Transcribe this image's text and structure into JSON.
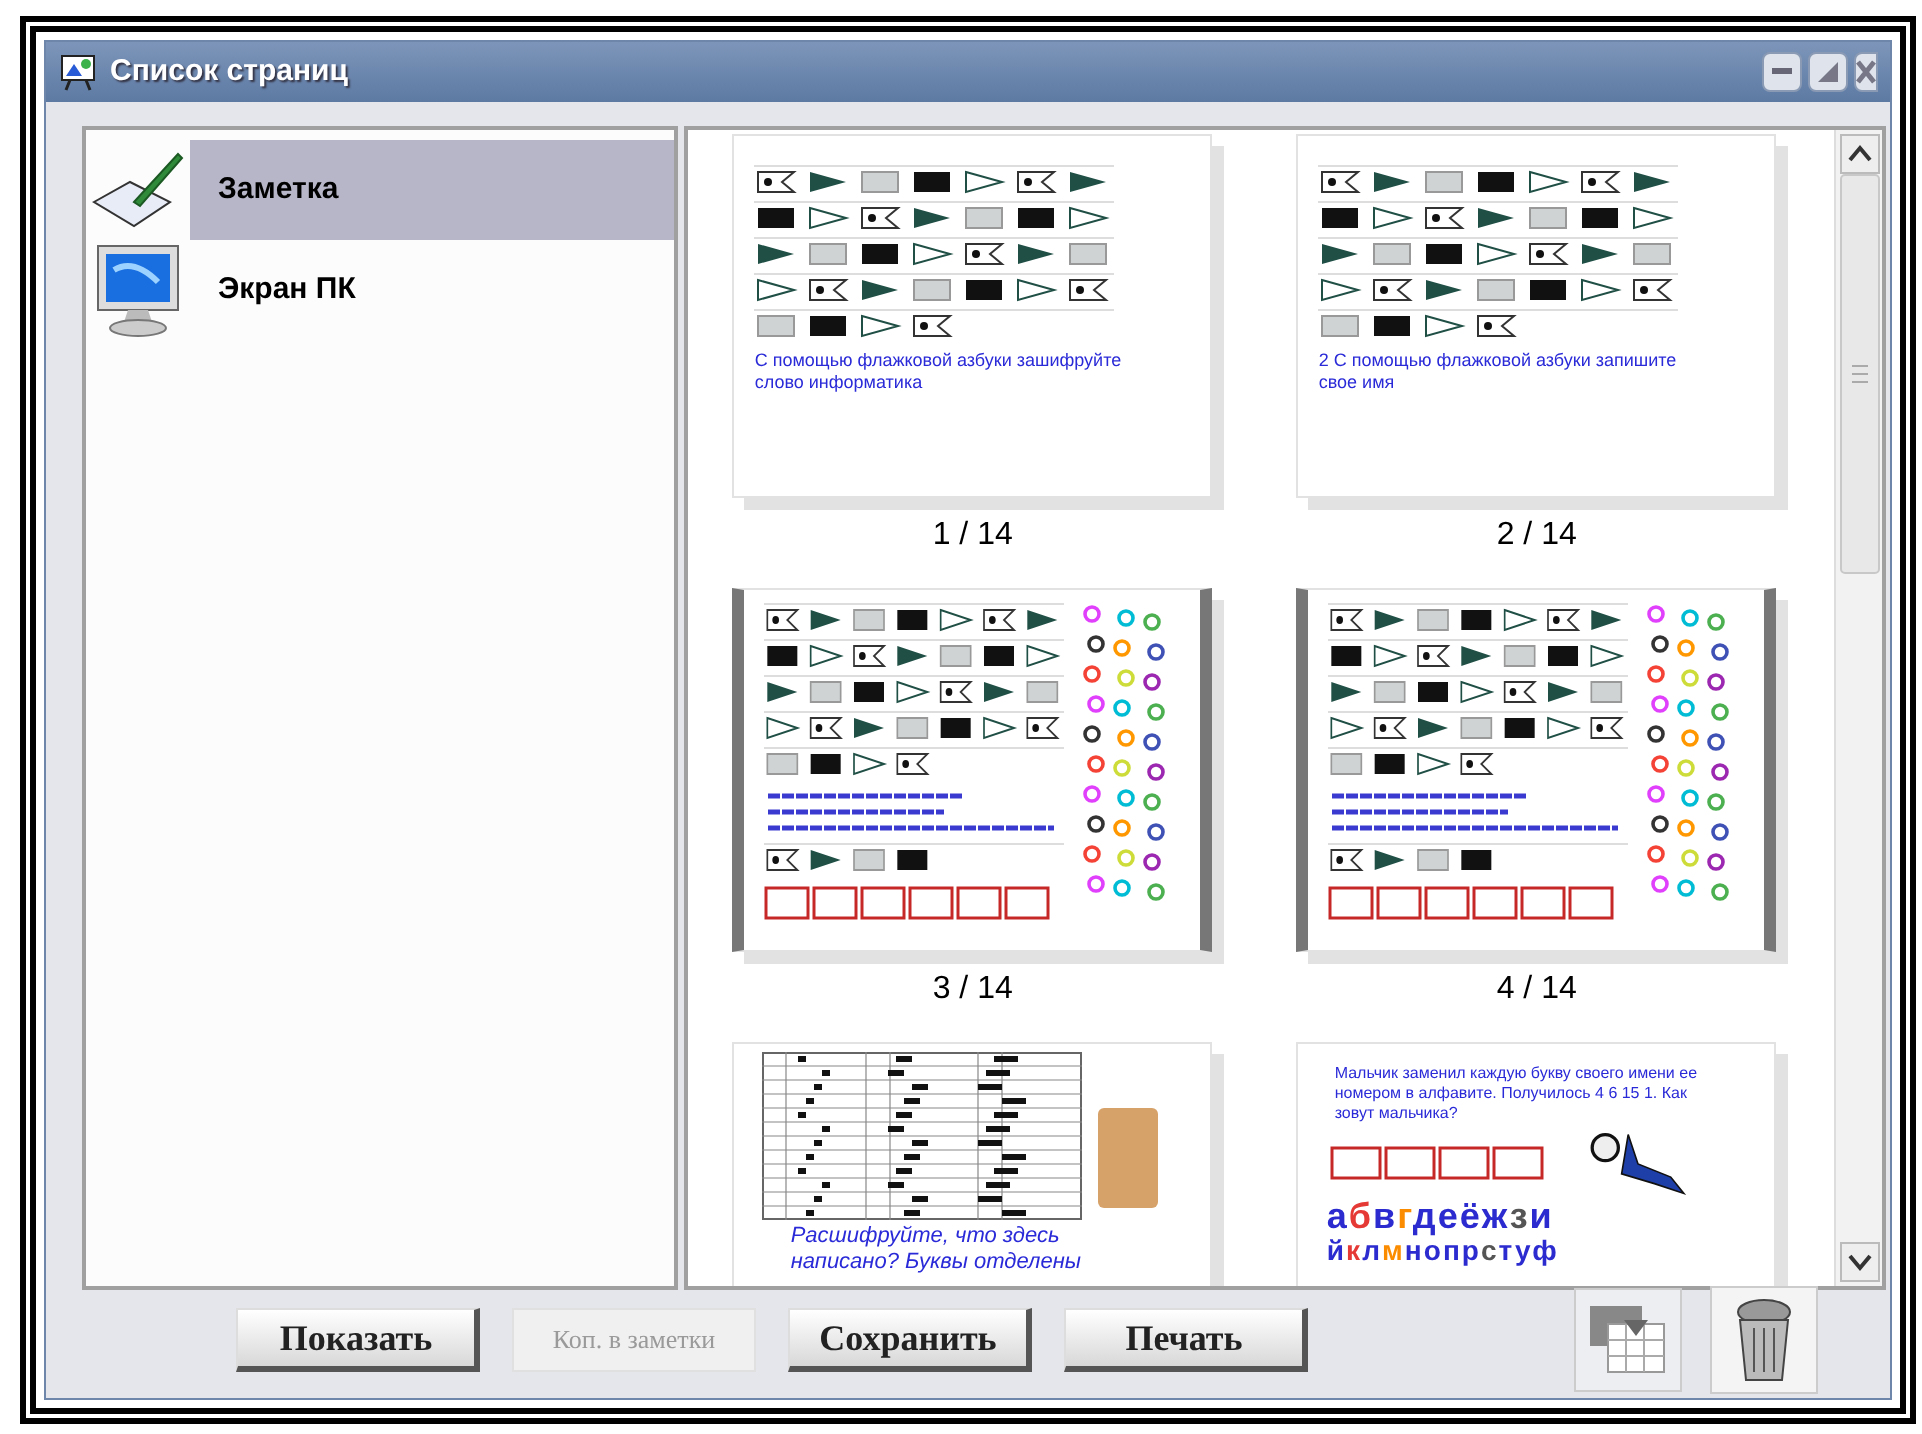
{
  "window": {
    "title": "Список страниц"
  },
  "sources": [
    {
      "label": "Заметка",
      "selected": true,
      "kind": "note"
    },
    {
      "label": "Экран ПК",
      "selected": false,
      "kind": "screen"
    }
  ],
  "pages": [
    {
      "kind": "flags-caption",
      "number": "1 / 14",
      "caption": "С помощью флажковой азбуки зашифруйте слово информатика"
    },
    {
      "kind": "flags-caption",
      "number": "2 / 14",
      "caption": "2 С помощью флажковой азбуки запишите свое имя"
    },
    {
      "kind": "flags-letters",
      "number": "3 / 14"
    },
    {
      "kind": "flags-letters",
      "number": "4 / 14"
    },
    {
      "kind": "morse",
      "caption": "Расшифруйте, что здесь написано? Буквы отделены"
    },
    {
      "kind": "alphabet",
      "caption": "Мальчик заменил каждую букву своего имени ее номером в алфавите. Получилось 4 6 15 1. Как зовут мальчика?",
      "lines": [
        "абвгдеёжзи",
        "йклмнопрстуф"
      ]
    }
  ],
  "buttons": [
    {
      "label": "Показать",
      "disabled": false
    },
    {
      "label": "Коп. в заметки",
      "disabled": true
    },
    {
      "label": "Сохранить",
      "disabled": false
    },
    {
      "label": "Печать",
      "disabled": false
    }
  ]
}
